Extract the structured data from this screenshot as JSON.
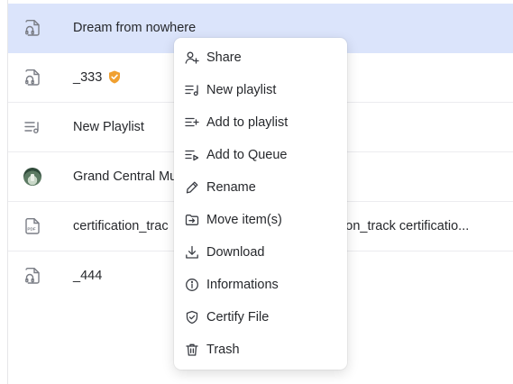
{
  "files": [
    {
      "name": "Dream from nowhere",
      "icon": "audio-file-icon",
      "selected": true
    },
    {
      "name": "_333",
      "icon": "audio-file-icon",
      "badge": "verified-badge-icon"
    },
    {
      "name": "New Playlist",
      "icon": "playlist-icon"
    },
    {
      "name": "Grand Central Mu",
      "icon": "image-thumbnail"
    },
    {
      "name": "certification_trac",
      "name_tail": "tion_track certificatio...",
      "icon": "pdf-file-icon"
    },
    {
      "name": "_444",
      "icon": "audio-file-icon"
    }
  ],
  "menu": {
    "items": [
      {
        "label": "Share",
        "icon": "share-user-icon"
      },
      {
        "label": "New playlist",
        "icon": "new-playlist-icon"
      },
      {
        "label": "Add to playlist",
        "icon": "add-to-playlist-icon"
      },
      {
        "label": "Add to Queue",
        "icon": "add-to-queue-icon"
      },
      {
        "label": "Rename",
        "icon": "pencil-icon"
      },
      {
        "label": "Move item(s)",
        "icon": "move-folder-icon"
      },
      {
        "label": "Download",
        "icon": "download-icon"
      },
      {
        "label": "Informations",
        "icon": "info-icon"
      },
      {
        "label": "Certify File",
        "icon": "shield-check-icon"
      },
      {
        "label": "Trash",
        "icon": "trash-icon"
      }
    ]
  },
  "colors": {
    "selected_row": "#dbe4fb",
    "badge": "#f0a030",
    "icon_gray": "#7a7d85"
  }
}
